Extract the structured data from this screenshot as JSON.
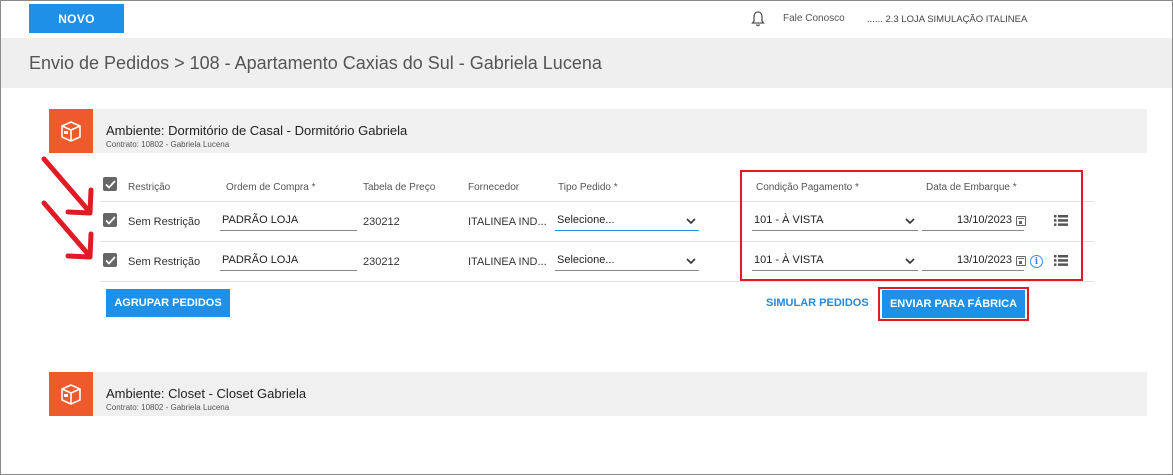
{
  "topbar": {
    "novo_label": "NOVO",
    "contact_label": "Fale Conosco",
    "store_label": "...... 2.3 LOJA SIMULAÇÃO ITALINEA"
  },
  "breadcrumb": "Envio de Pedidos > 108 - Apartamento Caxias do Sul - Gabriela Lucena",
  "ambientes": [
    {
      "title": "Ambiente: Dormitório de Casal - Dormitório Gabriela",
      "subtitle": "Contrato: 10802 - Gabriela Lucena"
    },
    {
      "title": "Ambiente: Closet - Closet Gabriela",
      "subtitle": "Contrato: 10802 - Gabriela Lucena"
    }
  ],
  "table": {
    "headers": [
      "Restrição",
      "Ordem de Compra *",
      "Tabela de Preço",
      "Fornecedor",
      "Tipo Pedido *",
      "Condição Pagamento *",
      "Data de Embarque *"
    ],
    "rows": [
      {
        "restricao": "Sem Restrição",
        "ordem": "PADRÃO LOJA",
        "tabela": "230212",
        "fornecedor": "ITALINEA IND...",
        "tipo": "Selecione...",
        "condicao": "101 - À VISTA",
        "data": "13/10/2023"
      },
      {
        "restricao": "Sem Restrição",
        "ordem": "PADRÃO LOJA",
        "tabela": "230212",
        "fornecedor": "ITALINEA IND...",
        "tipo": "Selecione...",
        "condicao": "101 - À VISTA",
        "data": "13/10/2023"
      }
    ]
  },
  "actions": {
    "agrupar_label": "AGRUPAR PEDIDOS",
    "simular_label": "SIMULAR PEDIDOS",
    "enviar_label": "ENVIAR PARA FÁBRICA"
  },
  "colors": {
    "accent": "#1e90e8",
    "ambiente_icon": "#ee5a2b",
    "highlight": "#e01b24"
  }
}
